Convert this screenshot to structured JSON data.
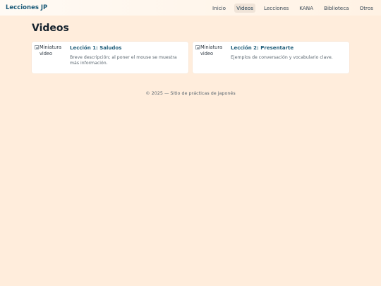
{
  "header": {
    "brand": "Lecciones JP",
    "nav": [
      {
        "label": "Inicio",
        "active": false
      },
      {
        "label": "Videos",
        "active": true
      },
      {
        "label": "Lecciones",
        "active": false
      },
      {
        "label": "KANA",
        "active": false
      },
      {
        "label": "Biblioteca",
        "active": false
      },
      {
        "label": "Otros",
        "active": false
      }
    ]
  },
  "main": {
    "title": "Videos",
    "cards": [
      {
        "thumb_alt": "Miniatura video",
        "title": "Lección 1: Saludos",
        "description": "Breve descripción; al poner el mouse se muestra más información."
      },
      {
        "thumb_alt": "Miniatura video",
        "title": "Lección 2: Presentarte",
        "description": "Ejemplos de conversación y vocabulario clave."
      }
    ]
  },
  "footer": {
    "text": "© 2025 — Sitio de prácticas de japonés"
  },
  "colors": {
    "background": "#ffeddc",
    "accent": "#1c5b78",
    "card": "#ffffff"
  }
}
